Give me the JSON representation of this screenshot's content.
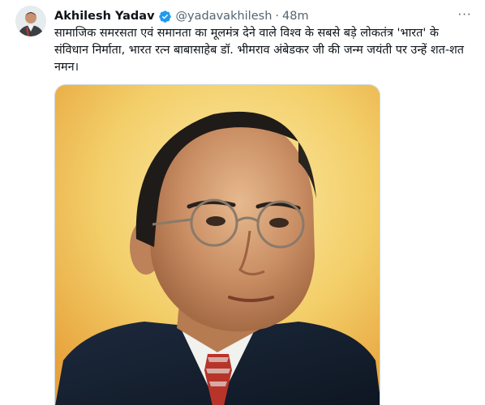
{
  "tweet": {
    "author_name": "Akhilesh Yadav",
    "handle": "@yadavakhilesh",
    "separator": "·",
    "time": "48m",
    "text": "सामाजिक समरसता एवं समानता का मूलमंत्र देने वाले विश्व के सबसे बड़े लोकतंत्र 'भारत' के संविधान निर्माता, भारत रत्न बाबासाहेब डॉ. भीमराव अंबेडकर जी की जन्म जयंती पर उन्हें शत-शत नमन।",
    "more_label": "···"
  },
  "icons": {
    "verified": "verified-badge-icon",
    "more": "more-options-icon"
  },
  "colors": {
    "verified_blue": "#1d9bf0",
    "secondary_text": "#536471",
    "primary_text": "#0f1419",
    "portrait_bg_top": "#f3d777",
    "portrait_bg_bottom": "#e9a43a"
  }
}
